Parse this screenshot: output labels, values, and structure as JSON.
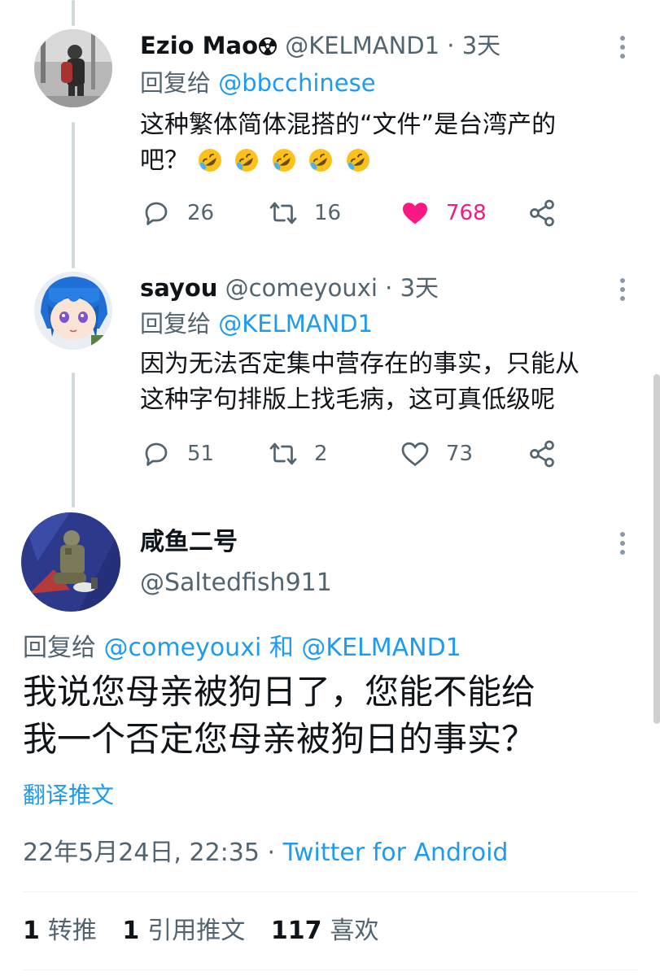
{
  "tweets": [
    {
      "name": "Ezio Mao",
      "handle": "@KELMAND1",
      "time": "3天",
      "reply_prefix": "回复给",
      "reply_to": "@bbcchinese",
      "text_line1": "这种繁体简体混搭的“文件”是台湾产的",
      "text_line2": "吧？",
      "emoji_count": 5,
      "emoji_name": "rolling-on-floor-laughing",
      "replies": "26",
      "retweets": "16",
      "likes": "768",
      "liked": true
    },
    {
      "name": "sayou",
      "handle": "@comeyouxi",
      "time": "3天",
      "reply_prefix": "回复给",
      "reply_to": "@KELMAND1",
      "text_line1": "因为无法否定集中营存在的事实，只能从",
      "text_line2": "这种字句排版上找毛病，这可真低级呢",
      "replies": "51",
      "retweets": "2",
      "likes": "73",
      "liked": false
    }
  ],
  "main_tweet": {
    "name": "咸鱼二号",
    "handle": "@Saltedfish911",
    "reply_prefix": "回复给",
    "reply_to_1": "@comeyouxi",
    "reply_and": "和",
    "reply_to_2": "@KELMAND1",
    "text_line1": "我说您母亲被狗日了，您能不能给",
    "text_line2": "我一个否定您母亲被狗日的事实？",
    "translate": "翻译推文",
    "datetime": "22年5月24日, 22:35",
    "separator": "·",
    "source": "Twitter for Android",
    "retweet_count": "1",
    "retweet_label": "转推",
    "quote_count": "1",
    "quote_label": "引用推文",
    "like_count": "117",
    "like_label": "喜欢"
  },
  "colors": {
    "link": "#1d9bf0",
    "secondary": "#536471",
    "like": "#f91880",
    "thread_line": "#cfd9de"
  },
  "icons": [
    "reply-icon",
    "retweet-icon",
    "like-icon",
    "share-icon",
    "more-icon",
    "radioactive-icon"
  ]
}
